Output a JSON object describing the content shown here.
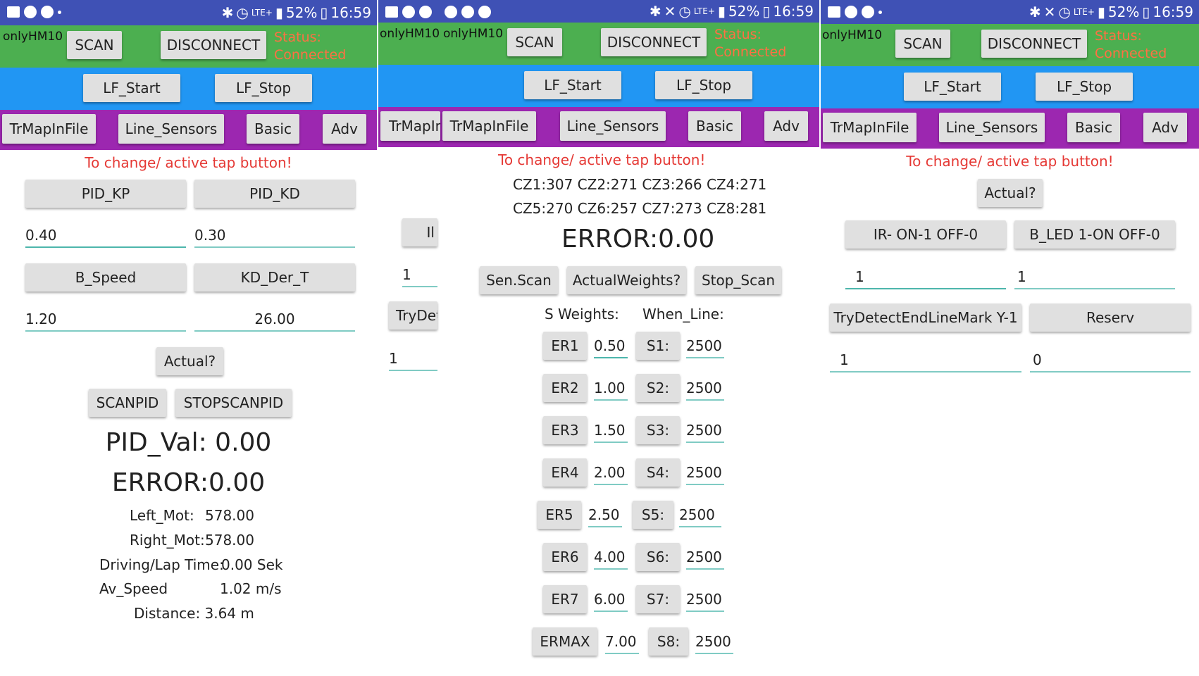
{
  "status_bar": {
    "battery": "52%",
    "time": "16:59",
    "network": "LTE+"
  },
  "common": {
    "device_name": "onlyHM10",
    "scan": "SCAN",
    "disconnect": "DISCONNECT",
    "status_label": "Status:",
    "status_value": "Connected",
    "lf_start": "LF_Start",
    "lf_stop": "LF_Stop",
    "tabs": [
      "TrMapInFile",
      "Line_Sensors",
      "Basic",
      "Adv"
    ],
    "hint": "To change/ active tap button!",
    "actual": "Actual?"
  },
  "basic": {
    "pid_kp": "PID_KP",
    "pid_kd": "PID_KD",
    "kp_value": "0.40",
    "kd_value": "0.30",
    "b_speed": "B_Speed",
    "kd_der_t": "KD_Der_T",
    "b_speed_value": "1.20",
    "kd_der_t_value": "26.00",
    "scanpid": "SCANPID",
    "stopscanpid": "STOPSCANPID",
    "pid_val": "PID_Val: 0.00",
    "error": "ERROR:0.00",
    "left_mot_label": "Left_Mot:",
    "left_mot_value": "578.00",
    "right_mot_label": "Right_Mot:",
    "right_mot_value": "578.00",
    "lap_label": "Driving/Lap Time:",
    "lap_value": "0.00 Sek",
    "speed_label": "Av_Speed",
    "speed_value": "1.02 m/s",
    "distance": "Distance: 3.64 m"
  },
  "sensors": {
    "device_name_overlay": "onlyHM10",
    "tab_overlay": "TrMapIn",
    "partial_button": "Il",
    "partial_value_1": "1",
    "partial_trydetect": "TryDete",
    "partial_value_2": "1",
    "cz_line1": "CZ1:307 CZ2:271 CZ3:266 CZ4:271",
    "cz_line2": "CZ5:270 CZ6:257 CZ7:273 CZ8:281",
    "error": "ERROR:0.00",
    "sen_scan": "Sen.Scan",
    "actual_weights": "ActualWeights?",
    "stop_scan": "Stop_Scan",
    "s_weights_label": "S Weights:",
    "when_line_label": "When_Line:",
    "rows": [
      {
        "er": "ER1",
        "er_val": "0.50",
        "s": "S1:",
        "s_val": "2500"
      },
      {
        "er": "ER2",
        "er_val": "1.00",
        "s": "S2:",
        "s_val": "2500"
      },
      {
        "er": "ER3",
        "er_val": "1.50",
        "s": "S3:",
        "s_val": "2500"
      },
      {
        "er": "ER4",
        "er_val": "2.00",
        "s": "S4:",
        "s_val": "2500"
      },
      {
        "er": "ER5",
        "er_val": "2.50",
        "s": "S5:",
        "s_val": "2500"
      },
      {
        "er": "ER6",
        "er_val": "4.00",
        "s": "S6:",
        "s_val": "2500"
      },
      {
        "er": "ER7",
        "er_val": "6.00",
        "s": "S7:",
        "s_val": "2500"
      },
      {
        "er": "ERMAX",
        "er_val": "7.00",
        "s": "S8:",
        "s_val": "2500"
      }
    ]
  },
  "adv": {
    "ir": "IR- ON-1 OFF-0",
    "bled": "B_LED 1-ON OFF-0",
    "ir_value": "1",
    "bled_value": "1",
    "trydetect": "TryDetectEndLineMark Y-1",
    "reserv": "Reserv",
    "trydetect_value": "1",
    "reserv_value": "0"
  },
  "colors": {
    "statusbar": "#3f51b5",
    "green": "#4caf50",
    "blue": "#2196f3",
    "purple": "#9c27b0",
    "status_text": "#ff7043",
    "hint_text": "#e53935"
  }
}
